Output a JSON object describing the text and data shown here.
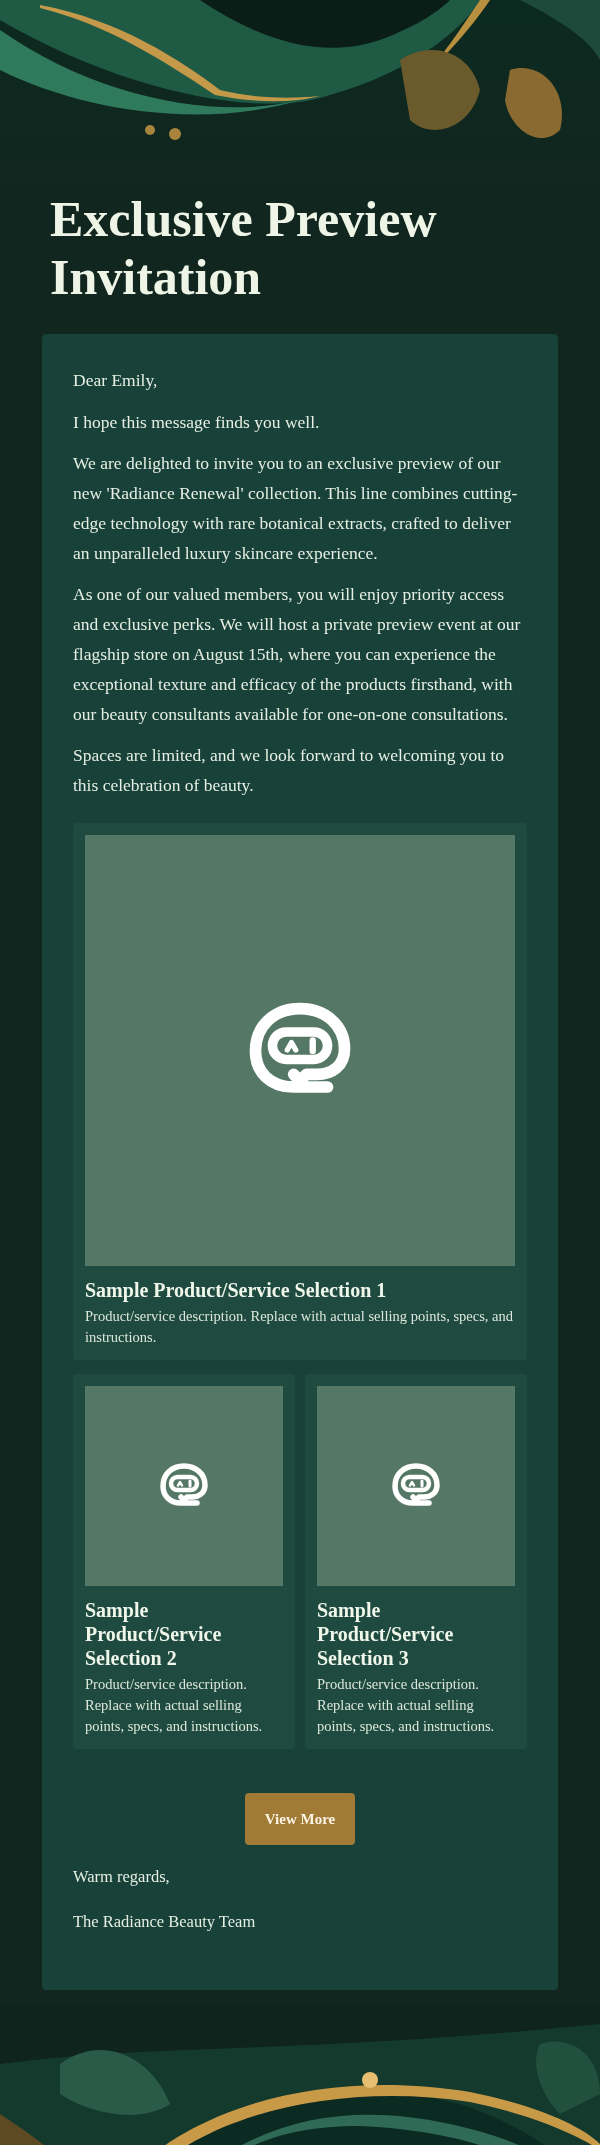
{
  "title": "Exclusive Preview Invitation",
  "greeting": "Dear Emily,",
  "paragraphs": [
    "I hope this message finds you well.",
    "We are delighted to invite you to an exclusive preview of our new 'Radiance Renewal' collection. This line combines cutting-edge technology with rare botanical extracts, crafted to deliver an unparalleled luxury skincare experience.",
    "As one of our valued members, you will enjoy priority access and exclusive perks. We will host a private preview event at our flagship store on August 15th, where you can experience the exceptional texture and efficacy of the products firsthand, with our beauty consultants available for one-on-one consultations.",
    "Spaces are limited, and we look forward to welcoming you to this celebration of beauty."
  ],
  "products": [
    {
      "title": "Sample Product/Service Selection 1",
      "description": "Product/service description. Replace with actual selling points, specs, and instructions."
    },
    {
      "title": "Sample Product/Service Selection 2",
      "description": "Product/service description. Replace with actual selling points, specs, and instructions."
    },
    {
      "title": "Sample Product/Service Selection 3",
      "description": "Product/service description. Replace with actual selling points, specs, and instructions."
    }
  ],
  "button": "View More",
  "closing": "Warm regards,",
  "signature": "The Radiance Beauty Team"
}
